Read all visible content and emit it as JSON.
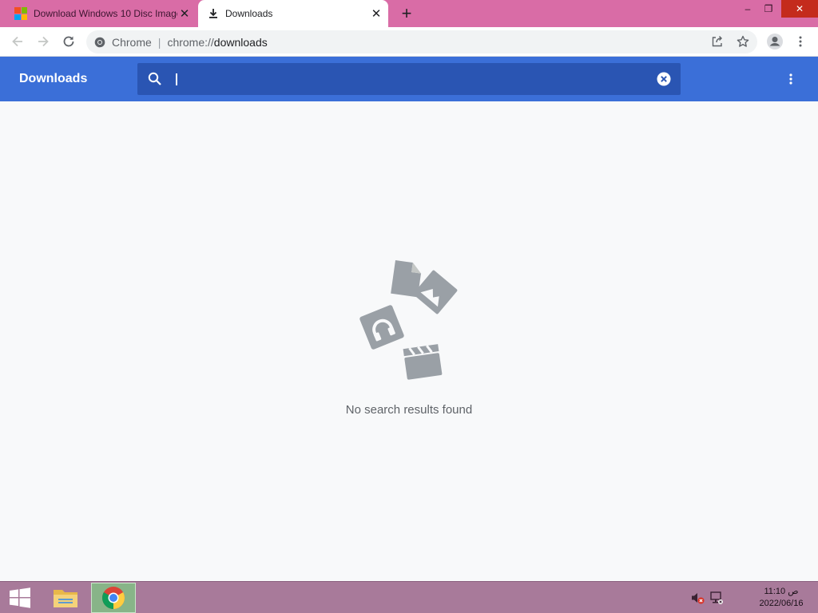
{
  "tabs": [
    {
      "title": "Download Windows 10 Disc Image",
      "active": false
    },
    {
      "title": "Downloads",
      "active": true
    }
  ],
  "window_controls": {
    "minimize": "–",
    "restore": "❐",
    "close": "✕"
  },
  "omnibox": {
    "chip_label": "Chrome",
    "separator": "|",
    "url_scheme": "chrome://",
    "url_path": "downloads"
  },
  "downloads": {
    "title": "Downloads",
    "search": {
      "value": "",
      "placeholder": ""
    },
    "empty_message": "No search results found"
  },
  "taskbar": {
    "clock_time": "11:10 ص",
    "clock_date": "2022/06/16"
  },
  "colors": {
    "tab_strip": "#d96ca6",
    "header_blue": "#3b6fd8",
    "search_blue": "#2a55b3",
    "taskbar": "#a87a9a"
  },
  "icons": {
    "back": "arrow-left-icon",
    "forward": "arrow-right-icon",
    "reload": "reload-icon",
    "share": "share-icon",
    "bookmark": "star-icon",
    "profile": "person-icon",
    "menu": "kebab-menu-icon",
    "search": "search-icon",
    "clear": "clear-icon"
  }
}
